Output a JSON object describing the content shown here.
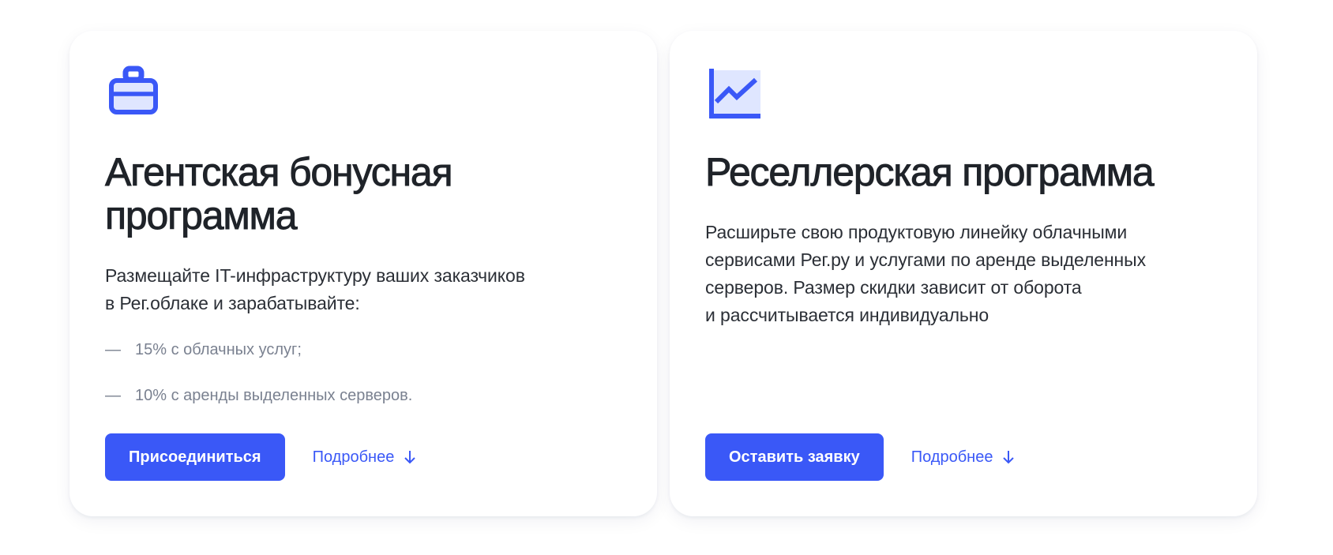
{
  "cards": [
    {
      "icon": "briefcase-icon",
      "title_line1": "Агентская бонусная",
      "title_line2": "программа",
      "desc_line1": "Размещайте IT-инфраструктуру ваших заказчиков",
      "desc_line2": "в Рег.облаке и зарабатывайте:",
      "list": [
        "15% с облачных услуг;",
        "10% с аренды выделенных серверов."
      ],
      "list_marker": "—",
      "button_label": "Присоединиться",
      "more_label": "Подробнее"
    },
    {
      "icon": "growth-chart-icon",
      "title_line1": "Реселлерская программа",
      "desc_line1": "Расширьте свою продуктовую линейку облачными",
      "desc_line2": "сервисами Рег.ру и услугами по аренде выделенных",
      "desc_line3": "серверов. Размер скидки зависит от оборота",
      "desc_line4": "и рассчитывается индивидуально",
      "button_label": "Оставить заявку",
      "more_label": "Подробнее"
    }
  ],
  "colors": {
    "accent": "#3a58f7",
    "icon_fill_light": "#dfe6ff",
    "title": "#1f2329",
    "text": "#2b2f36",
    "muted": "#7a8190"
  }
}
